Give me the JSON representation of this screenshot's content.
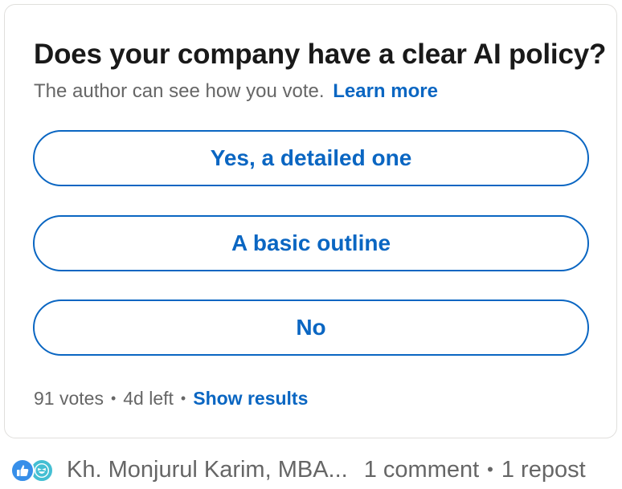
{
  "poll": {
    "question": "Does your company have a clear AI policy?",
    "visibility_note": "The author can see how you vote.",
    "learn_more": "Learn more",
    "options": [
      "Yes, a detailed one",
      "A basic outline",
      "No"
    ],
    "votes": "91 votes",
    "time_left": "4d left",
    "show_results": "Show results"
  },
  "social": {
    "reactions": [
      "like-icon",
      "funny-icon"
    ],
    "reaction_names": "Kh. Monjurul Karim, MBA...",
    "comments": "1 comment",
    "reposts": "1 repost"
  },
  "colors": {
    "accent": "#0a66c2",
    "muted_text": "#666666",
    "like": "#378fe9",
    "funny": "#44bfd3"
  }
}
